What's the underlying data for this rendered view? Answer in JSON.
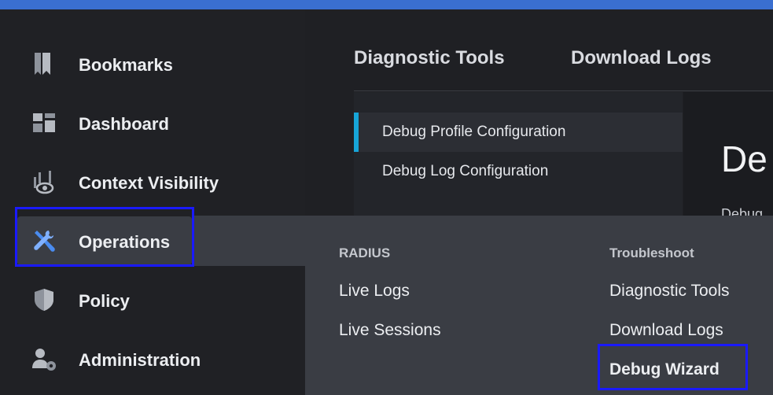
{
  "nav": {
    "items": [
      {
        "label": "Bookmarks",
        "icon": "bookmark-icon"
      },
      {
        "label": "Dashboard",
        "icon": "dashboard-icon"
      },
      {
        "label": "Context Visibility",
        "icon": "context-visibility-icon"
      },
      {
        "label": "Operations",
        "icon": "wrench-screwdriver-icon"
      },
      {
        "label": "Policy",
        "icon": "shield-icon"
      },
      {
        "label": "Administration",
        "icon": "user-gear-icon"
      }
    ]
  },
  "tabs": [
    "Diagnostic Tools",
    "Download Logs"
  ],
  "subnav": {
    "items": [
      "Debug Profile Configuration",
      "Debug Log Configuration"
    ]
  },
  "content": {
    "heading": "De",
    "subtext": "Debug"
  },
  "flyout": {
    "radius": {
      "heading": "RADIUS",
      "links": [
        "Live Logs",
        "Live Sessions"
      ]
    },
    "troubleshoot": {
      "heading": "Troubleshoot",
      "links": [
        "Diagnostic Tools",
        "Download Logs",
        "Debug Wizard"
      ]
    }
  },
  "colors": {
    "accent": "#17a5d8",
    "topbar": "#3a6fd0",
    "highlight": "#1a1aff",
    "operations_icon": "#4a8cf0"
  }
}
